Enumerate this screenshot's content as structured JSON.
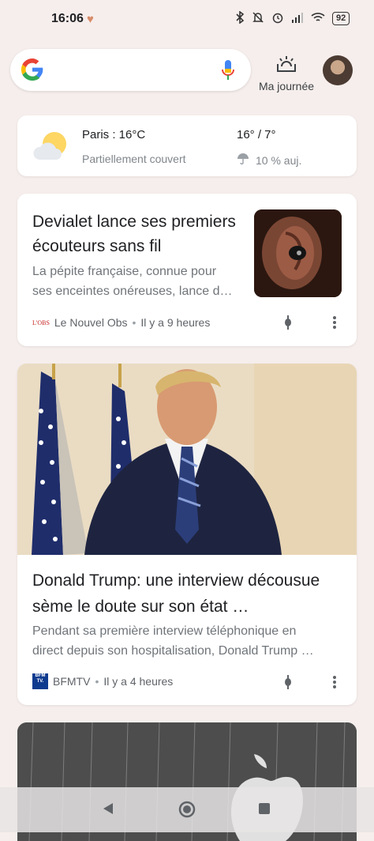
{
  "status_bar": {
    "time": "16:06",
    "battery": "92",
    "icons": [
      "heart-icon",
      "bluetooth-icon",
      "mute-icon",
      "alarm-icon",
      "signal-icon",
      "wifi-icon",
      "battery-icon"
    ]
  },
  "search": {
    "placeholder": "",
    "my_day_label": "Ma journée"
  },
  "weather": {
    "city_temp": "Paris : 16°C",
    "condition": "Partiellement couvert",
    "high_low": "16° / 7°",
    "rain": "10 % auj."
  },
  "articles": [
    {
      "title_line1": "Devialet lance ses premiers",
      "title_line2": "écouteurs sans fil",
      "desc_line1": "La pépite française, connue pour",
      "desc_line2": "ses enceintes onéreuses, lance d…",
      "source_logo": "L'OBS",
      "source": "Le Nouvel Obs",
      "time": "Il y a 9 heures"
    },
    {
      "title_line1": "Donald Trump: une interview décousue",
      "title_line2": "sème le doute sur son état …",
      "desc_line1": "Pendant sa première interview téléphonique en",
      "desc_line2": "direct depuis son hospitalisation, Donald Trump …",
      "source_logo": "BFM TV.",
      "source": "BFMTV",
      "time": "Il y a 4 heures"
    }
  ],
  "colors": {
    "background": "#f6eeec",
    "card": "#ffffff",
    "title": "#202124",
    "secondary": "#70757a"
  }
}
